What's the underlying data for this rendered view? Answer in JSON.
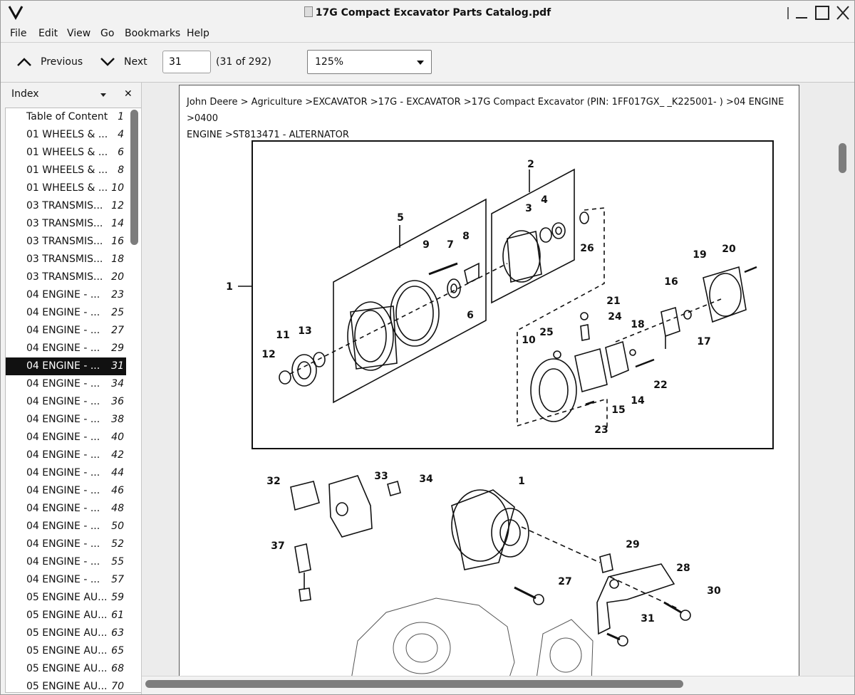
{
  "window": {
    "title": "17G Compact Excavator Parts Catalog.pdf"
  },
  "menu": [
    "File",
    "Edit",
    "View",
    "Go",
    "Bookmarks",
    "Help"
  ],
  "toolbar": {
    "previous_label": "Previous",
    "next_label": "Next",
    "page_value": "31",
    "page_count": "(31 of 292)",
    "zoom": "125%"
  },
  "sidebar": {
    "title": "Index",
    "items": [
      {
        "label": "Table of Content",
        "page": "1"
      },
      {
        "label": "01 WHEELS & ...",
        "page": "4"
      },
      {
        "label": "01 WHEELS & ...",
        "page": "6"
      },
      {
        "label": "01 WHEELS & ...",
        "page": "8"
      },
      {
        "label": "01 WHEELS & ...",
        "page": "10"
      },
      {
        "label": "03 TRANSMIS...",
        "page": "12"
      },
      {
        "label": "03 TRANSMIS...",
        "page": "14"
      },
      {
        "label": "03 TRANSMIS...",
        "page": "16"
      },
      {
        "label": "03 TRANSMIS...",
        "page": "18"
      },
      {
        "label": "03 TRANSMIS...",
        "page": "20"
      },
      {
        "label": "04 ENGINE  - ...",
        "page": "23"
      },
      {
        "label": "04 ENGINE  - ...",
        "page": "25"
      },
      {
        "label": "04 ENGINE  - ...",
        "page": "27"
      },
      {
        "label": "04 ENGINE  - ...",
        "page": "29"
      },
      {
        "label": "04 ENGINE  - ...",
        "page": "31"
      },
      {
        "label": "04 ENGINE  - ...",
        "page": "34"
      },
      {
        "label": "04 ENGINE  - ...",
        "page": "36"
      },
      {
        "label": "04 ENGINE  - ...",
        "page": "38"
      },
      {
        "label": "04 ENGINE  - ...",
        "page": "40"
      },
      {
        "label": "04 ENGINE  - ...",
        "page": "42"
      },
      {
        "label": "04 ENGINE  - ...",
        "page": "44"
      },
      {
        "label": "04 ENGINE  - ...",
        "page": "46"
      },
      {
        "label": "04 ENGINE  - ...",
        "page": "48"
      },
      {
        "label": "04 ENGINE  - ...",
        "page": "50"
      },
      {
        "label": "04 ENGINE  - ...",
        "page": "52"
      },
      {
        "label": "04 ENGINE  - ...",
        "page": "55"
      },
      {
        "label": "04 ENGINE  - ...",
        "page": "57"
      },
      {
        "label": "05 ENGINE AU...",
        "page": "59"
      },
      {
        "label": "05 ENGINE AU...",
        "page": "61"
      },
      {
        "label": "05 ENGINE AU...",
        "page": "63"
      },
      {
        "label": "05 ENGINE AU...",
        "page": "65"
      },
      {
        "label": "05 ENGINE AU...",
        "page": "68"
      },
      {
        "label": "05 ENGINE AU...",
        "page": "70"
      }
    ],
    "selected_index": 14
  },
  "document": {
    "breadcrumb_line1": "John Deere > Agriculture >EXCAVATOR >17G - EXCAVATOR >17G Compact Excavator (PIN: 1FF017GX_ _K225001- ) >04 ENGINE >0400",
    "breadcrumb_line2": "ENGINE >ST813471 - ALTERNATOR",
    "callouts_diagram1": [
      "1",
      "2",
      "3",
      "4",
      "5",
      "6",
      "7",
      "8",
      "9",
      "10",
      "11",
      "12",
      "13",
      "14",
      "15",
      "16",
      "17",
      "18",
      "19",
      "20",
      "21",
      "22",
      "23",
      "24",
      "25",
      "26"
    ],
    "callouts_diagram2": [
      "1",
      "27",
      "28",
      "29",
      "30",
      "31",
      "32",
      "33",
      "34",
      "37"
    ]
  }
}
